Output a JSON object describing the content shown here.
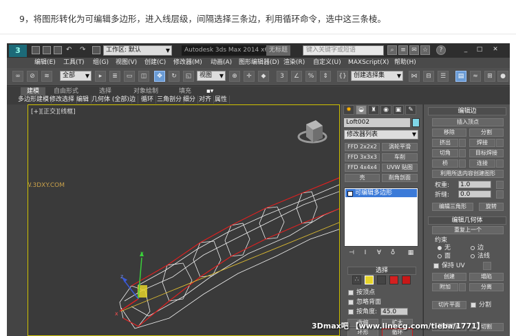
{
  "caption": "9，将图形转化为可编辑多边形，进入线层级，间隔选择三条边，利用循环命令，选中这三条棱。",
  "titlebar": {
    "workspace": "工作区: 默认",
    "app_title": "Autodesk 3ds Max  2014 x64",
    "untitled": "无标题",
    "search_placeholder": "键入关键字或短语"
  },
  "menu": [
    "编辑(E)",
    "工具(T)",
    "组(G)",
    "视图(V)",
    "创建(C)",
    "修改器(M)",
    "动画(A)",
    "图形编辑器(D)",
    "渲染(R)",
    "自定义(U)",
    "MAXScript(X)",
    "帮助(H)"
  ],
  "toolbar": {
    "filter": "全部",
    "ref_coord": "视图",
    "named_sel": "创建选择集"
  },
  "ribbon": {
    "tabs": [
      "建模",
      "自由形式",
      "选择",
      "对象绘制",
      "填充"
    ],
    "subtabs": [
      "多边形建模",
      "修改选择",
      "编辑",
      "几何体 (全部)",
      "边",
      "循环",
      "三角剖分",
      "细分",
      "对齐",
      "属性"
    ]
  },
  "viewport": {
    "label": "[+][正交][线框]",
    "wm_small": "WWW.3DXY.COM"
  },
  "cmd": {
    "object_name": "Loft002",
    "object_color": "#7fd6e8",
    "modifier_list": "修改器列表",
    "buttons": [
      "FFD 2x2x2",
      "涡轮平滑",
      "FFD 3x3x3",
      "车削",
      "FFD 4x4x4",
      "UVW 贴图",
      "壳",
      "削角剖面"
    ],
    "stack_item": "可编辑多边形",
    "selection_title": "选择",
    "by_vertex": "按顶点",
    "ignore_backface": "忽略背面",
    "by_angle": "按角度:",
    "angle": "45.0",
    "shrink": "收缩",
    "grow": "扩大",
    "ring": "环形",
    "loop": "循环"
  },
  "edit": {
    "title": "编辑边",
    "insert_vertex": "插入顶点",
    "remove": "移除",
    "split": "分割",
    "extrude": "挤出",
    "weld": "焊接",
    "chamfer": "切角",
    "target_weld": "目标焊接",
    "bridge": "桥",
    "connect": "连接",
    "create_shape": "利用所选内容创建图形",
    "weight": "权重:",
    "weight_val": "1.0",
    "crease": "折缝:",
    "crease_val": "0.0",
    "edit_tri": "编辑三角形",
    "turn": "旋转",
    "geo_title": "编辑几何体",
    "repeat_last": "重复上一个",
    "constraints": "约束",
    "none": "无",
    "edge": "边",
    "face": "面",
    "normal": "法线",
    "preserve_uv": "保持 UV",
    "create": "创建",
    "collapse": "塌陷",
    "attach": "附加",
    "detach": "分离",
    "slice_plane": "切片平面",
    "split2": "分割",
    "quickslice": "快速切片",
    "cut": "切割"
  },
  "watermark": "3Dmax吧  【www.linecg.com/tieba/1771】"
}
